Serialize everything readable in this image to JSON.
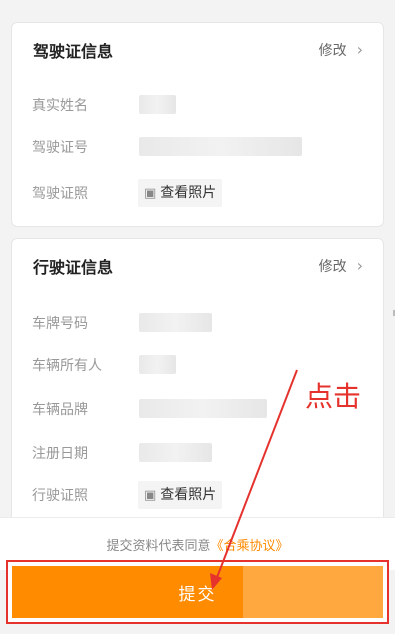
{
  "license_card": {
    "title": "驾驶证信息",
    "edit_label": "修改",
    "rows": [
      {
        "label": "真实姓名"
      },
      {
        "label": "驾驶证号"
      },
      {
        "label": "驾驶证照",
        "button": "查看照片"
      }
    ]
  },
  "vehicle_card": {
    "title": "行驶证信息",
    "edit_label": "修改",
    "rows": [
      {
        "label": "车牌号码"
      },
      {
        "label": "车辆所有人"
      },
      {
        "label": "车辆品牌"
      },
      {
        "label": "注册日期"
      },
      {
        "label": "行驶证照",
        "button": "查看照片"
      }
    ]
  },
  "agreement": {
    "prefix": "提交资料代表同意",
    "link": "《合乘协议》"
  },
  "submit": {
    "label": "提交"
  },
  "annotation": {
    "text": "点击"
  },
  "colors": {
    "accent": "#ff8c00",
    "highlight": "#e5322d",
    "link": "#ff8a00"
  }
}
